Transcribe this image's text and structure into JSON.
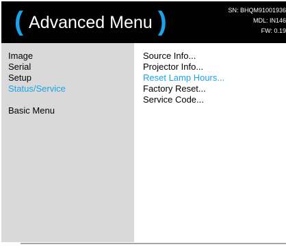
{
  "header": {
    "title": "Advanced Menu",
    "paren_open": "(",
    "paren_close": ")",
    "serial": "SN: BHQM91001936",
    "model": "MDL: IN146",
    "firmware": "FW: 0.19"
  },
  "left_menu": {
    "items": [
      {
        "label": "Image"
      },
      {
        "label": "Serial"
      },
      {
        "label": "Setup"
      },
      {
        "label": "Status/Service",
        "selected": true
      }
    ],
    "basic_menu_label": "Basic Menu"
  },
  "right_menu": {
    "items": [
      {
        "label": "Source Info..."
      },
      {
        "label": "Projector Info..."
      },
      {
        "label": "Reset Lamp Hours...",
        "highlighted": true
      },
      {
        "label": "Factory Reset..."
      },
      {
        "label": "Service Code..."
      }
    ]
  },
  "colors": {
    "accent": "#1aa3e8",
    "header_bg": "#000000",
    "left_panel_bg": "#d9d9d9",
    "right_panel_bg": "#ffffff"
  }
}
